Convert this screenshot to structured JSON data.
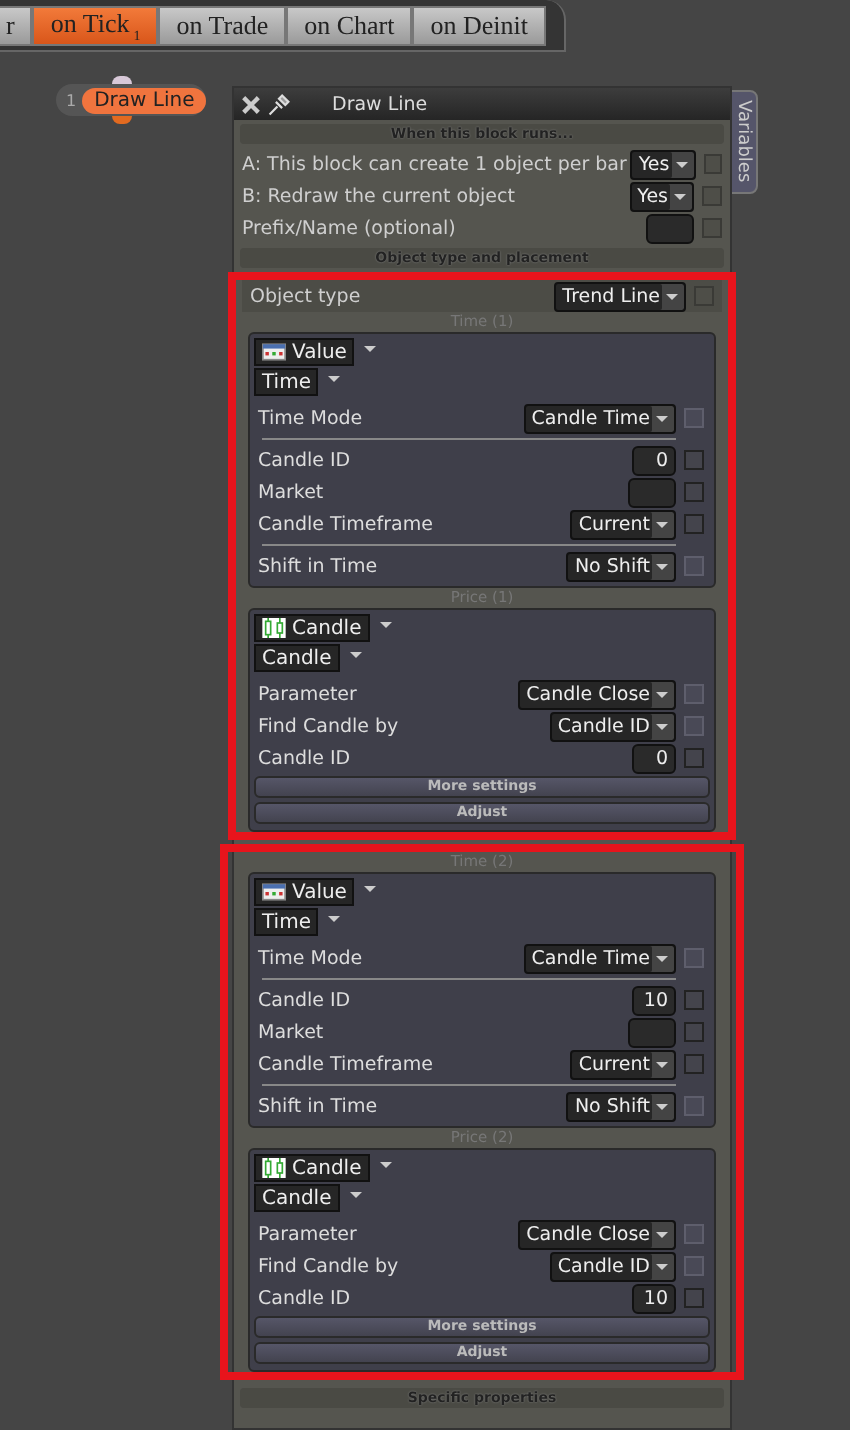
{
  "tabs": [
    {
      "label": "r",
      "selected": false
    },
    {
      "label": "on Tick",
      "badge": "1",
      "selected": true
    },
    {
      "label": "on Trade",
      "selected": false
    },
    {
      "label": "on Chart",
      "selected": false
    },
    {
      "label": "on Deinit",
      "selected": false
    }
  ],
  "node": {
    "number": "1",
    "label": "Draw Line"
  },
  "panel": {
    "title": "Draw Line",
    "side_tab": "Variables",
    "runs_header": "When this block runs...",
    "run_rows": [
      {
        "kind": "select",
        "label": "A: This block can create 1 object per bar",
        "value": "Yes",
        "checked": false
      },
      {
        "kind": "select",
        "label": "B: Redraw the current object",
        "value": "Yes",
        "checked": false
      },
      {
        "kind": "input",
        "label": "Prefix/Name (optional)",
        "checked": false
      }
    ],
    "placement_header": "Object type and placement",
    "object_type": {
      "label": "Object type",
      "value": "Trend Line",
      "checked": false
    },
    "sections": [
      {
        "groups": [
          {
            "title": "Time (1)",
            "source": {
              "kind": "value",
              "label": "Value"
            },
            "subtype": "Time",
            "params": [
              {
                "kind": "select",
                "label": "Time Mode",
                "value": "Candle Time",
                "disabled": true
              },
              {
                "kind": "divider"
              },
              {
                "kind": "input",
                "label": "Candle ID",
                "value": "0",
                "disabled": false
              },
              {
                "kind": "input",
                "label": "Market",
                "disabled": false
              },
              {
                "kind": "select",
                "label": "Candle Timeframe",
                "value": "Current",
                "disabled": false
              },
              {
                "kind": "divider"
              },
              {
                "kind": "select",
                "label": "Shift in Time",
                "value": "No Shift",
                "disabled": true
              }
            ]
          },
          {
            "title": "Price (1)",
            "source": {
              "kind": "candle",
              "label": "Candle"
            },
            "subtype": "Candle",
            "params": [
              {
                "kind": "select",
                "label": "Parameter",
                "value": "Candle Close",
                "disabled": true
              },
              {
                "kind": "select",
                "label": "Find Candle by",
                "value": "Candle ID",
                "disabled": true
              },
              {
                "kind": "input",
                "label": "Candle ID",
                "value": "0",
                "disabled": false
              }
            ],
            "buttons": [
              "More settings",
              "Adjust"
            ]
          }
        ]
      },
      {
        "groups": [
          {
            "title": "Time (2)",
            "source": {
              "kind": "value",
              "label": "Value"
            },
            "subtype": "Time",
            "params": [
              {
                "kind": "select",
                "label": "Time Mode",
                "value": "Candle Time",
                "disabled": true
              },
              {
                "kind": "divider"
              },
              {
                "kind": "input",
                "label": "Candle ID",
                "value": "10",
                "disabled": false
              },
              {
                "kind": "input",
                "label": "Market",
                "disabled": false
              },
              {
                "kind": "select",
                "label": "Candle Timeframe",
                "value": "Current",
                "disabled": false
              },
              {
                "kind": "divider"
              },
              {
                "kind": "select",
                "label": "Shift in Time",
                "value": "No Shift",
                "disabled": true
              }
            ]
          },
          {
            "title": "Price (2)",
            "source": {
              "kind": "candle",
              "label": "Candle"
            },
            "subtype": "Candle",
            "params": [
              {
                "kind": "select",
                "label": "Parameter",
                "value": "Candle Close",
                "disabled": true
              },
              {
                "kind": "select",
                "label": "Find Candle by",
                "value": "Candle ID",
                "disabled": true
              },
              {
                "kind": "input",
                "label": "Candle ID",
                "value": "10",
                "disabled": false
              }
            ],
            "buttons": [
              "More settings",
              "Adjust"
            ]
          }
        ]
      }
    ],
    "footer": "Specific properties"
  }
}
